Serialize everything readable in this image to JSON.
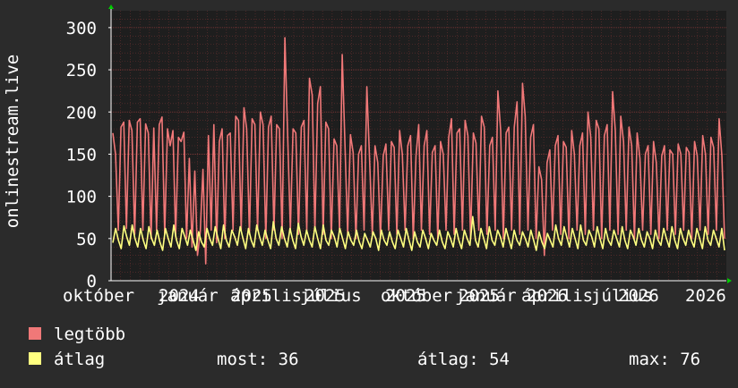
{
  "chart_data": {
    "type": "line",
    "ylabel": "onlinestream.live",
    "ylim": [
      0,
      320
    ],
    "yticks": [
      0,
      50,
      100,
      150,
      200,
      250,
      300
    ],
    "grid": true,
    "x_tick_labels": [
      "október",
      "január",
      "2024",
      "április",
      "2025",
      "július",
      "2025",
      "október",
      "2025",
      "január",
      "2025",
      "április",
      "2026",
      "július",
      "2026",
      "2026"
    ],
    "x_range": [
      "2024-10",
      "2026-08"
    ],
    "series": [
      {
        "name": "legtöbb",
        "color": "#f07878",
        "values": [
          175,
          150,
          60,
          182,
          188,
          62,
          190,
          178,
          55,
          188,
          192,
          60,
          186,
          175,
          50,
          181,
          60,
          185,
          194,
          55,
          180,
          160,
          178,
          52,
          170,
          165,
          176,
          50,
          145,
          40,
          130,
          30,
          58,
          132,
          20,
          172,
          60,
          185,
          45,
          165,
          180,
          50,
          172,
          175,
          60,
          195,
          190,
          60,
          205,
          180,
          55,
          192,
          185,
          60,
          200,
          185,
          50,
          182,
          195,
          60,
          185,
          180,
          50,
          288,
          175,
          60,
          180,
          175,
          55,
          182,
          190,
          60,
          240,
          220,
          60,
          210,
          230,
          55,
          188,
          180,
          50,
          168,
          160,
          60,
          268,
          160,
          55,
          173,
          152,
          50,
          150,
          160,
          60,
          230,
          145,
          55,
          160,
          140,
          50,
          148,
          162,
          60,
          165,
          158,
          55,
          178,
          150,
          60,
          160,
          172,
          50,
          148,
          185,
          60,
          160,
          178,
          55,
          152,
          160,
          50,
          165,
          150,
          60,
          170,
          192,
          55,
          175,
          180,
          60,
          190,
          172,
          50,
          175,
          163,
          60,
          195,
          182,
          55,
          160,
          170,
          60,
          225,
          178,
          50,
          175,
          182,
          60,
          182,
          212,
          55,
          234,
          195,
          60,
          170,
          185,
          50,
          135,
          120,
          30,
          140,
          155,
          60,
          160,
          172,
          55,
          165,
          158,
          50,
          178,
          150,
          60,
          160,
          175,
          55,
          200,
          170,
          60,
          190,
          180,
          50,
          172,
          185,
          60,
          224,
          178,
          55,
          195,
          165,
          60,
          182,
          160,
          50,
          175,
          145,
          60,
          150,
          160,
          55,
          165,
          140,
          50,
          148,
          160,
          60,
          155,
          150,
          55,
          162,
          150,
          60,
          158,
          152,
          50,
          165,
          148,
          60,
          172,
          150,
          55,
          170,
          158,
          60,
          192,
          148,
          50
        ]
      },
      {
        "name": "átlag",
        "color": "#ffff80",
        "values": [
          45,
          62,
          48,
          38,
          65,
          52,
          42,
          66,
          50,
          40,
          62,
          48,
          38,
          64,
          50,
          42,
          60,
          46,
          36,
          62,
          50,
          40,
          66,
          48,
          38,
          62,
          52,
          42,
          60,
          48,
          36,
          58,
          46,
          40,
          62,
          50,
          42,
          64,
          50,
          38,
          66,
          48,
          40,
          60,
          52,
          42,
          64,
          50,
          38,
          62,
          48,
          40,
          66,
          52,
          42,
          60,
          48,
          38,
          70,
          50,
          42,
          64,
          50,
          40,
          62,
          48,
          38,
          68,
          52,
          42,
          60,
          48,
          40,
          64,
          50,
          38,
          66,
          48,
          42,
          60,
          52,
          40,
          62,
          50,
          38,
          58,
          48,
          42,
          60,
          46,
          38,
          56,
          48,
          40,
          58,
          50,
          36,
          60,
          48,
          42,
          58,
          46,
          38,
          60,
          50,
          40,
          62,
          48,
          36,
          58,
          46,
          40,
          60,
          50,
          38,
          56,
          48,
          42,
          60,
          46,
          38,
          58,
          50,
          40,
          62,
          48,
          38,
          60,
          50,
          42,
          76,
          48,
          40,
          62,
          50,
          38,
          64,
          48,
          42,
          60,
          52,
          40,
          62,
          50,
          38,
          60,
          48,
          42,
          58,
          50,
          40,
          60,
          48,
          36,
          58,
          46,
          38,
          56,
          48,
          40,
          66,
          50,
          42,
          64,
          52,
          40,
          62,
          50,
          38,
          66,
          48,
          42,
          60,
          52,
          40,
          64,
          50,
          38,
          62,
          48,
          42,
          60,
          50,
          40,
          64,
          48,
          38,
          60,
          52,
          42,
          62,
          48,
          40,
          58,
          50,
          38,
          60,
          48,
          42,
          62,
          50,
          40,
          64,
          48,
          38,
          62,
          50,
          42,
          60,
          48,
          40,
          62,
          50,
          38,
          64,
          48,
          42,
          60,
          50,
          40,
          62,
          36
        ]
      }
    ]
  },
  "legend": {
    "items": [
      {
        "label": "legtöbb",
        "color": "#f07878"
      },
      {
        "label": "átlag",
        "color": "#ffff80"
      }
    ],
    "stats": {
      "most": "most: 36",
      "atlag": "átlag: 54",
      "max": "max: 76"
    }
  },
  "colors": {
    "background": "#2b2b2b",
    "plot_background": "#1e1e1e",
    "grid": "#6a3030",
    "axis": "#ffffff",
    "arrow": "#00cc00"
  }
}
